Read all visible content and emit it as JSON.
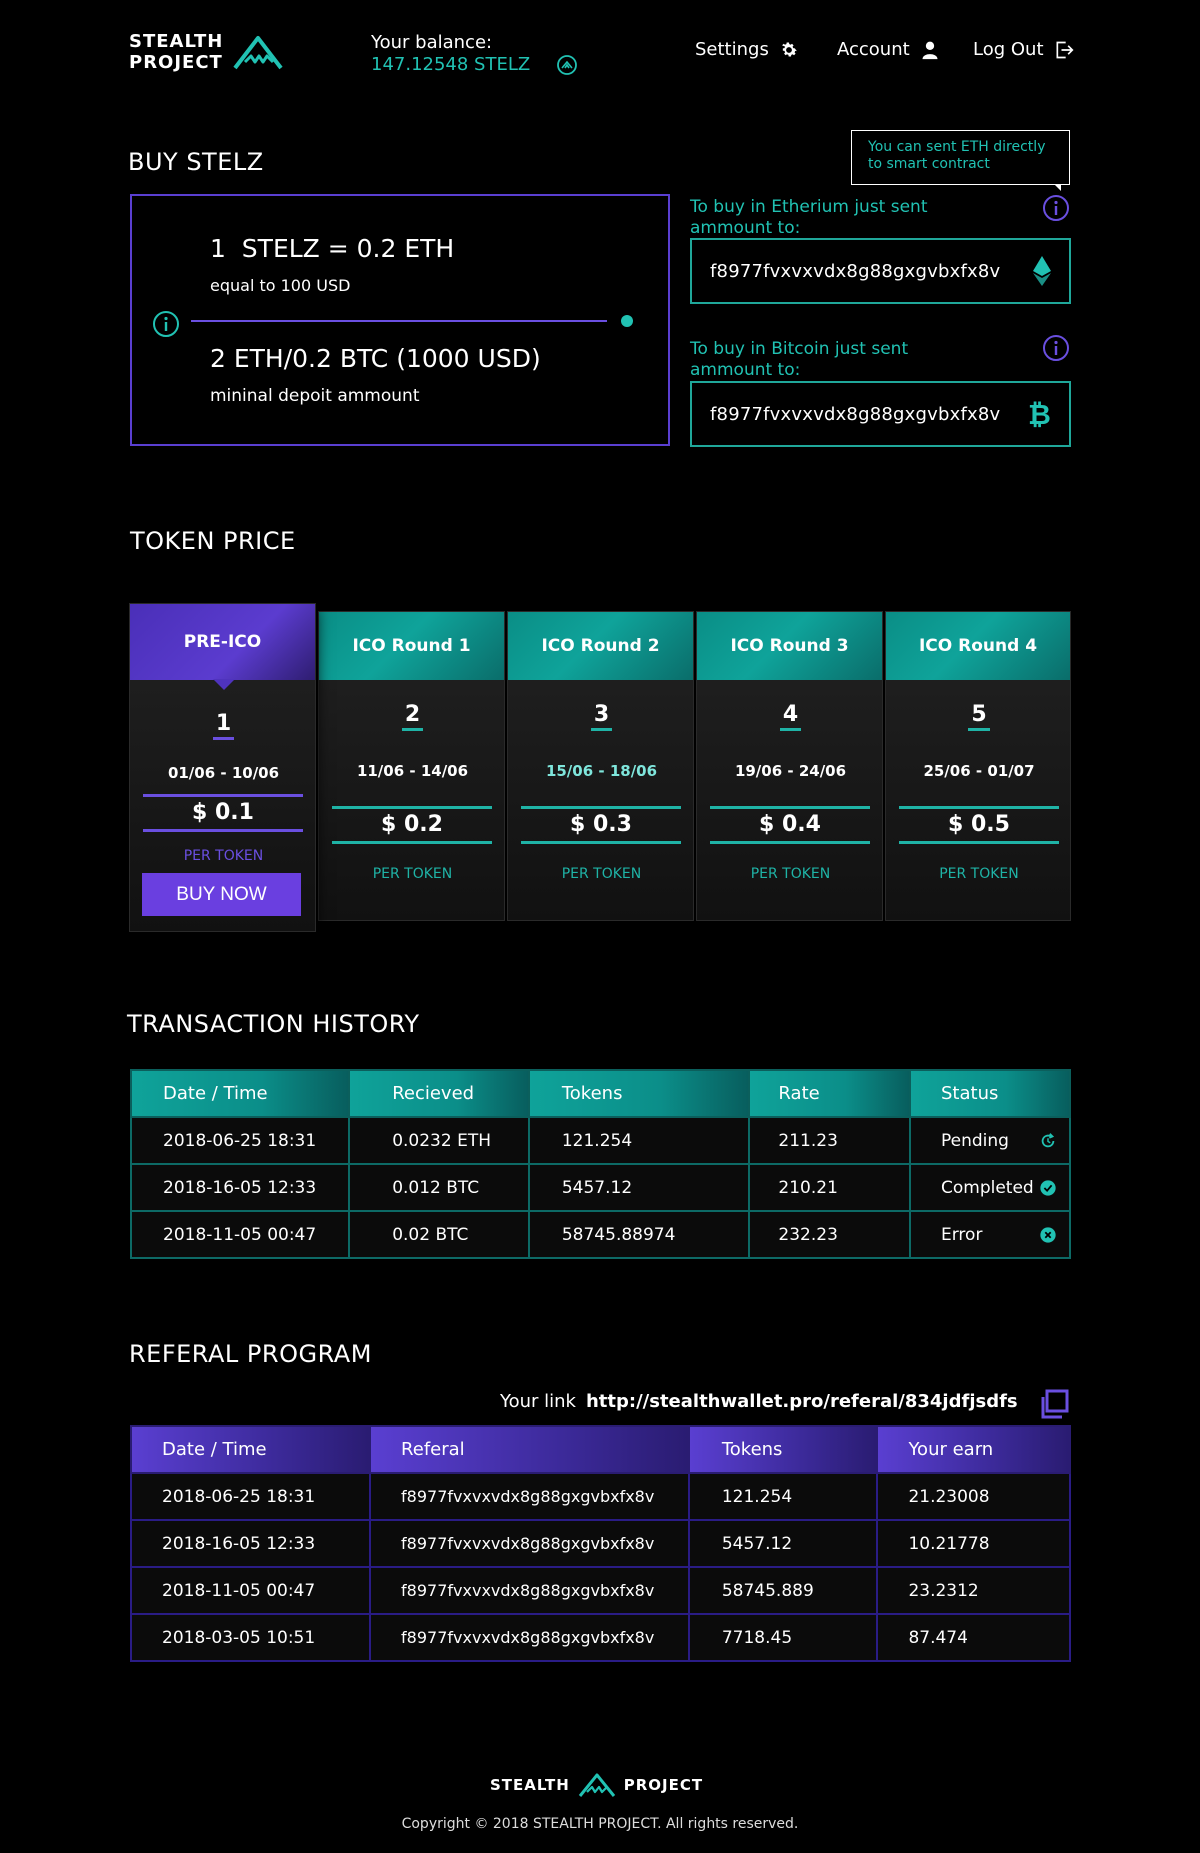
{
  "header": {
    "logo_line1": "STEALTH",
    "logo_line2": "PROJECT",
    "balance_label": "Your balance:",
    "balance_value": "147.12548 STELZ",
    "nav": {
      "settings": "Settings",
      "account": "Account",
      "logout": "Log Out"
    }
  },
  "buy": {
    "title": "BUY STELZ",
    "rate_line": "1  STELZ = 0.2 ETH",
    "rate_sub": "equal to 100 USD",
    "min_line": "2 ETH/0.2 BTC (1000 USD)",
    "min_sub": "mininal depoit ammount",
    "tooltip": "You can sent ETH directly to smart contract",
    "eth_label": "To buy in Etherium just sent ammount to:",
    "eth_address": "f8977fvxvxvdx8g88gxgvbxfx8v",
    "btc_label": "To buy in Bitcoin just sent ammount to:",
    "btc_address": "f8977fvxvxvdx8g88gxgvbxfx8v"
  },
  "token_price": {
    "title": "TOKEN PRICE",
    "per_label": "PER TOKEN",
    "buy_label": "BUY NOW",
    "rounds": [
      {
        "name": "PRE-ICO",
        "num": "1",
        "dates": "01/06 - 10/06",
        "price": "$ 0.1"
      },
      {
        "name": "ICO Round 1",
        "num": "2",
        "dates": "11/06 - 14/06",
        "price": "$ 0.2"
      },
      {
        "name": "ICO Round 2",
        "num": "3",
        "dates": "15/06 - 18/06",
        "price": "$ 0.3"
      },
      {
        "name": "ICO Round 3",
        "num": "4",
        "dates": "19/06 - 24/06",
        "price": "$ 0.4"
      },
      {
        "name": "ICO Round 4",
        "num": "5",
        "dates": "25/06 - 01/07",
        "price": "$ 0.5"
      }
    ]
  },
  "transactions": {
    "title": "TRANSACTION HISTORY",
    "columns": [
      "Date / Time",
      "Recieved",
      "Tokens",
      "Rate",
      "Status"
    ],
    "rows": [
      {
        "date": "2018-06-25 18:31",
        "received": "0.0232 ETH",
        "tokens": "121.254",
        "rate": "211.23",
        "status": "Pending"
      },
      {
        "date": "2018-16-05 12:33",
        "received": "0.012 BTC",
        "tokens": "5457.12",
        "rate": "210.21",
        "status": "Completed"
      },
      {
        "date": "2018-11-05 00:47",
        "received": "0.02 BTC",
        "tokens": "58745.88974",
        "rate": "232.23",
        "status": "Error"
      }
    ]
  },
  "referral": {
    "title": "REFERAL PROGRAM",
    "link_label": "Your link",
    "link_value": "http://stealthwallet.pro/referal/834jdfjsdfs",
    "columns": [
      "Date / Time",
      "Referal",
      "Tokens",
      "Your earn"
    ],
    "rows": [
      {
        "date": "2018-06-25 18:31",
        "referal": "f8977fvxvxvdx8g88gxgvbxfx8v",
        "tokens": "121.254",
        "earn": "21.23008"
      },
      {
        "date": "2018-16-05 12:33",
        "referal": "f8977fvxvxvdx8g88gxgvbxfx8v",
        "tokens": "5457.12",
        "earn": "10.21778"
      },
      {
        "date": "2018-11-05 00:47",
        "referal": "f8977fvxvxvdx8g88gxgvbxfx8v",
        "tokens": "58745.889",
        "earn": "23.2312"
      },
      {
        "date": "2018-03-05 10:51",
        "referal": "f8977fvxvxvdx8g88gxgvbxfx8v",
        "tokens": "7718.45",
        "earn": "87.474"
      }
    ]
  },
  "footer": {
    "logo_left": "STEALTH",
    "logo_right": "PROJECT",
    "copyright": "Copyright © 2018 STEALTH PROJECT. All rights reserved."
  },
  "colors": {
    "teal": "#21c2b3",
    "purple": "#6a4fe0",
    "background": "#000000"
  },
  "icons": [
    "logo-mountain-icon",
    "balance-icon",
    "gear-icon",
    "user-icon",
    "logout-icon",
    "info-icon",
    "ethereum-icon",
    "bitcoin-icon",
    "pending-icon",
    "completed-icon",
    "error-icon",
    "copy-icon"
  ]
}
